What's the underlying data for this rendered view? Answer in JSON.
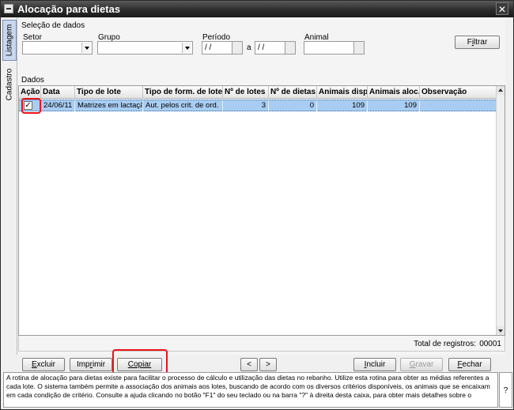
{
  "window": {
    "title": "Alocação para dietas",
    "close_glyph": "✕"
  },
  "tabs": {
    "listagem": "Listagem",
    "cadastro": "Cadastro"
  },
  "filters": {
    "section_title": "Seleção de dados",
    "setor_label": "Setor",
    "setor_value": "",
    "grupo_label": "Grupo",
    "grupo_value": "",
    "periodo_label": "Período",
    "periodo_from": " / /",
    "periodo_sep": "a",
    "periodo_to": " / /",
    "animal_label": "Animal",
    "animal_value": "",
    "filtrar_prefix": "F",
    "filtrar_accel": "i",
    "filtrar_rest": "ltrar"
  },
  "data_section": {
    "title": "Dados"
  },
  "grid": {
    "columns": [
      "Ação",
      "Data",
      "Tipo de lote",
      "Tipo de form. de lote",
      "Nº de lotes",
      "Nº de dietas",
      "Animais disp.",
      "Animais aloc.",
      "Observação"
    ],
    "rows": [
      {
        "acao_checked": "✓",
        "data": "24/06/11",
        "tipo_lote": "Matrizes em lactação",
        "tipo_form": "Aut. pelos crit. de ord.",
        "n_lotes": "3",
        "n_dietas": "0",
        "animais_disp": "109",
        "animais_aloc": "109",
        "observacao": ""
      }
    ]
  },
  "footer": {
    "total_label": "Total de registros:",
    "total_value": "00001"
  },
  "buttons": {
    "excluir_accel": "E",
    "excluir_rest": "xcluir",
    "imprimir_prefix": "Imp",
    "imprimir_accel": "r",
    "imprimir_rest": "imir",
    "copiar_accel": "C",
    "copiar_rest": "opiar",
    "prev": "<",
    "next": ">",
    "incluir_accel": "I",
    "incluir_rest": "ncluir",
    "gravar_accel": "G",
    "gravar_rest": "ravar",
    "fechar_accel": "F",
    "fechar_rest": "echar"
  },
  "help": {
    "text": "A rotina de alocação para dietas existe para facilitar o processo de cálculo e utilização das dietas no rebanho. Utilize esta rotina para obter as médias referentes a cada lote. O sistema também permite a associação dos animais aos lotes, buscando de acordo com os diversos critérios disponíveis, os animais que se encaixam em cada condição de critério. Consulte a ajuda clicando no botão \"F1\" do seu teclado ou na barra \"?\" à direita desta caixa, para obter mais detalhes sobre o",
    "question": "?"
  },
  "colors": {
    "selection_row": "#a9cdf2",
    "highlight_red": "#e8141a",
    "titlebar": "#2b2b2b"
  }
}
